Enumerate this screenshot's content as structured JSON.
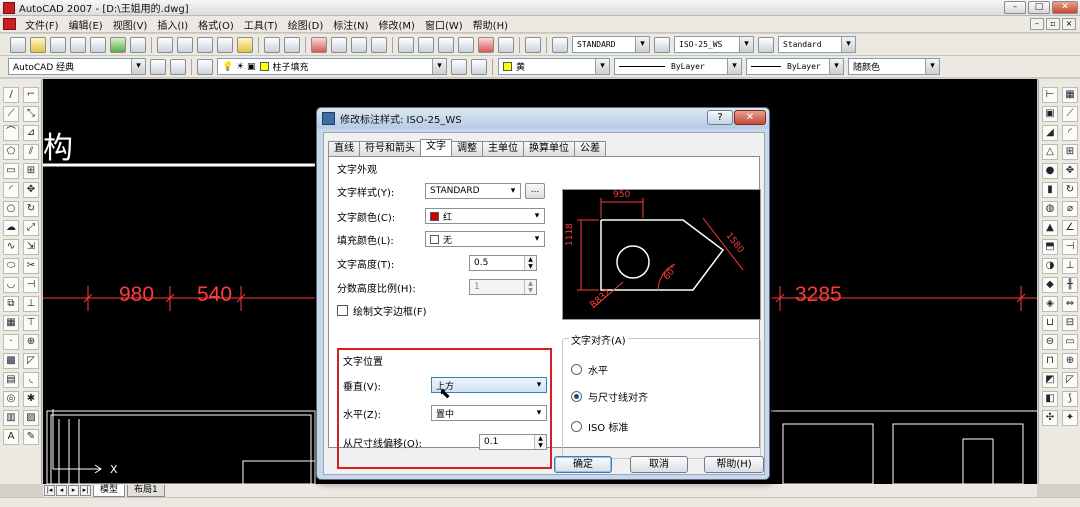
{
  "window": {
    "title": "AutoCAD 2007 - [D:\\王姐用的.dwg]",
    "minimize": "–",
    "restore": "□",
    "close": "✕"
  },
  "menubar": {
    "items": [
      "文件(F)",
      "编辑(E)",
      "视图(V)",
      "插入(I)",
      "格式(O)",
      "工具(T)",
      "绘图(D)",
      "标注(N)",
      "修改(M)",
      "窗口(W)",
      "帮助(H)"
    ],
    "mdi_min": "–",
    "mdi_restore": "▫",
    "mdi_close": "×"
  },
  "toolbar1": {
    "text_style": "STANDARD",
    "dim_style": "ISO-25_WS",
    "table_style": "Standard"
  },
  "toolbar2": {
    "workspace": "AutoCAD 经典",
    "layer": "柱子填充",
    "color": "黄",
    "linetype": "ByLayer",
    "lineweight": "ByLayer",
    "plot_style": "随颜色",
    "colors": {
      "layer_yellow": "#ffff00",
      "color_yellow": "#ffff00"
    }
  },
  "canvas": {
    "struct_char": "构",
    "dims": [
      "980",
      "540",
      "3285"
    ],
    "dim_color": "#ff3b3b",
    "ucs_x": "X"
  },
  "layout_tabs": {
    "model": "模型",
    "layout1": "布局1"
  },
  "dialog": {
    "title": "修改标注样式: ISO-25_WS",
    "help_button": "?",
    "close_button": "✕",
    "tabs": [
      "直线",
      "符号和箭头",
      "文字",
      "调整",
      "主单位",
      "换算单位",
      "公差"
    ],
    "active_tab": "文字",
    "text_appearance": {
      "title": "文字外观",
      "style_label": "文字样式(Y):",
      "style_value": "STANDARD",
      "style_btn": "...",
      "color_label": "文字颜色(C):",
      "color_value": "红",
      "color_swatch": "#cc0000",
      "fill_label": "填充颜色(L):",
      "fill_value": "无",
      "height_label": "文字高度(T):",
      "height_value": "0.5",
      "fraction_label": "分数高度比例(H):",
      "fraction_value": "1",
      "frame_label": "绘制文字边框(F)"
    },
    "text_placement": {
      "title": "文字位置",
      "vertical_label": "垂直(V):",
      "vertical_value": "上方",
      "horizontal_label": "水平(Z):",
      "horizontal_value": "置中",
      "offset_label": "从尺寸线偏移(O):",
      "offset_value": "0.1"
    },
    "text_alignment": {
      "title": "文字对齐(A)",
      "options": [
        "水平",
        "与尺寸线对齐",
        "ISO 标准"
      ],
      "selected": "与尺寸线对齐"
    },
    "preview": {
      "dim_top": "950",
      "dim_left": "1118",
      "dim_right": "1580",
      "angle": "60°",
      "radius": "R832"
    },
    "buttons": {
      "ok": "确定",
      "cancel": "取消",
      "help": "帮助(H)"
    }
  }
}
